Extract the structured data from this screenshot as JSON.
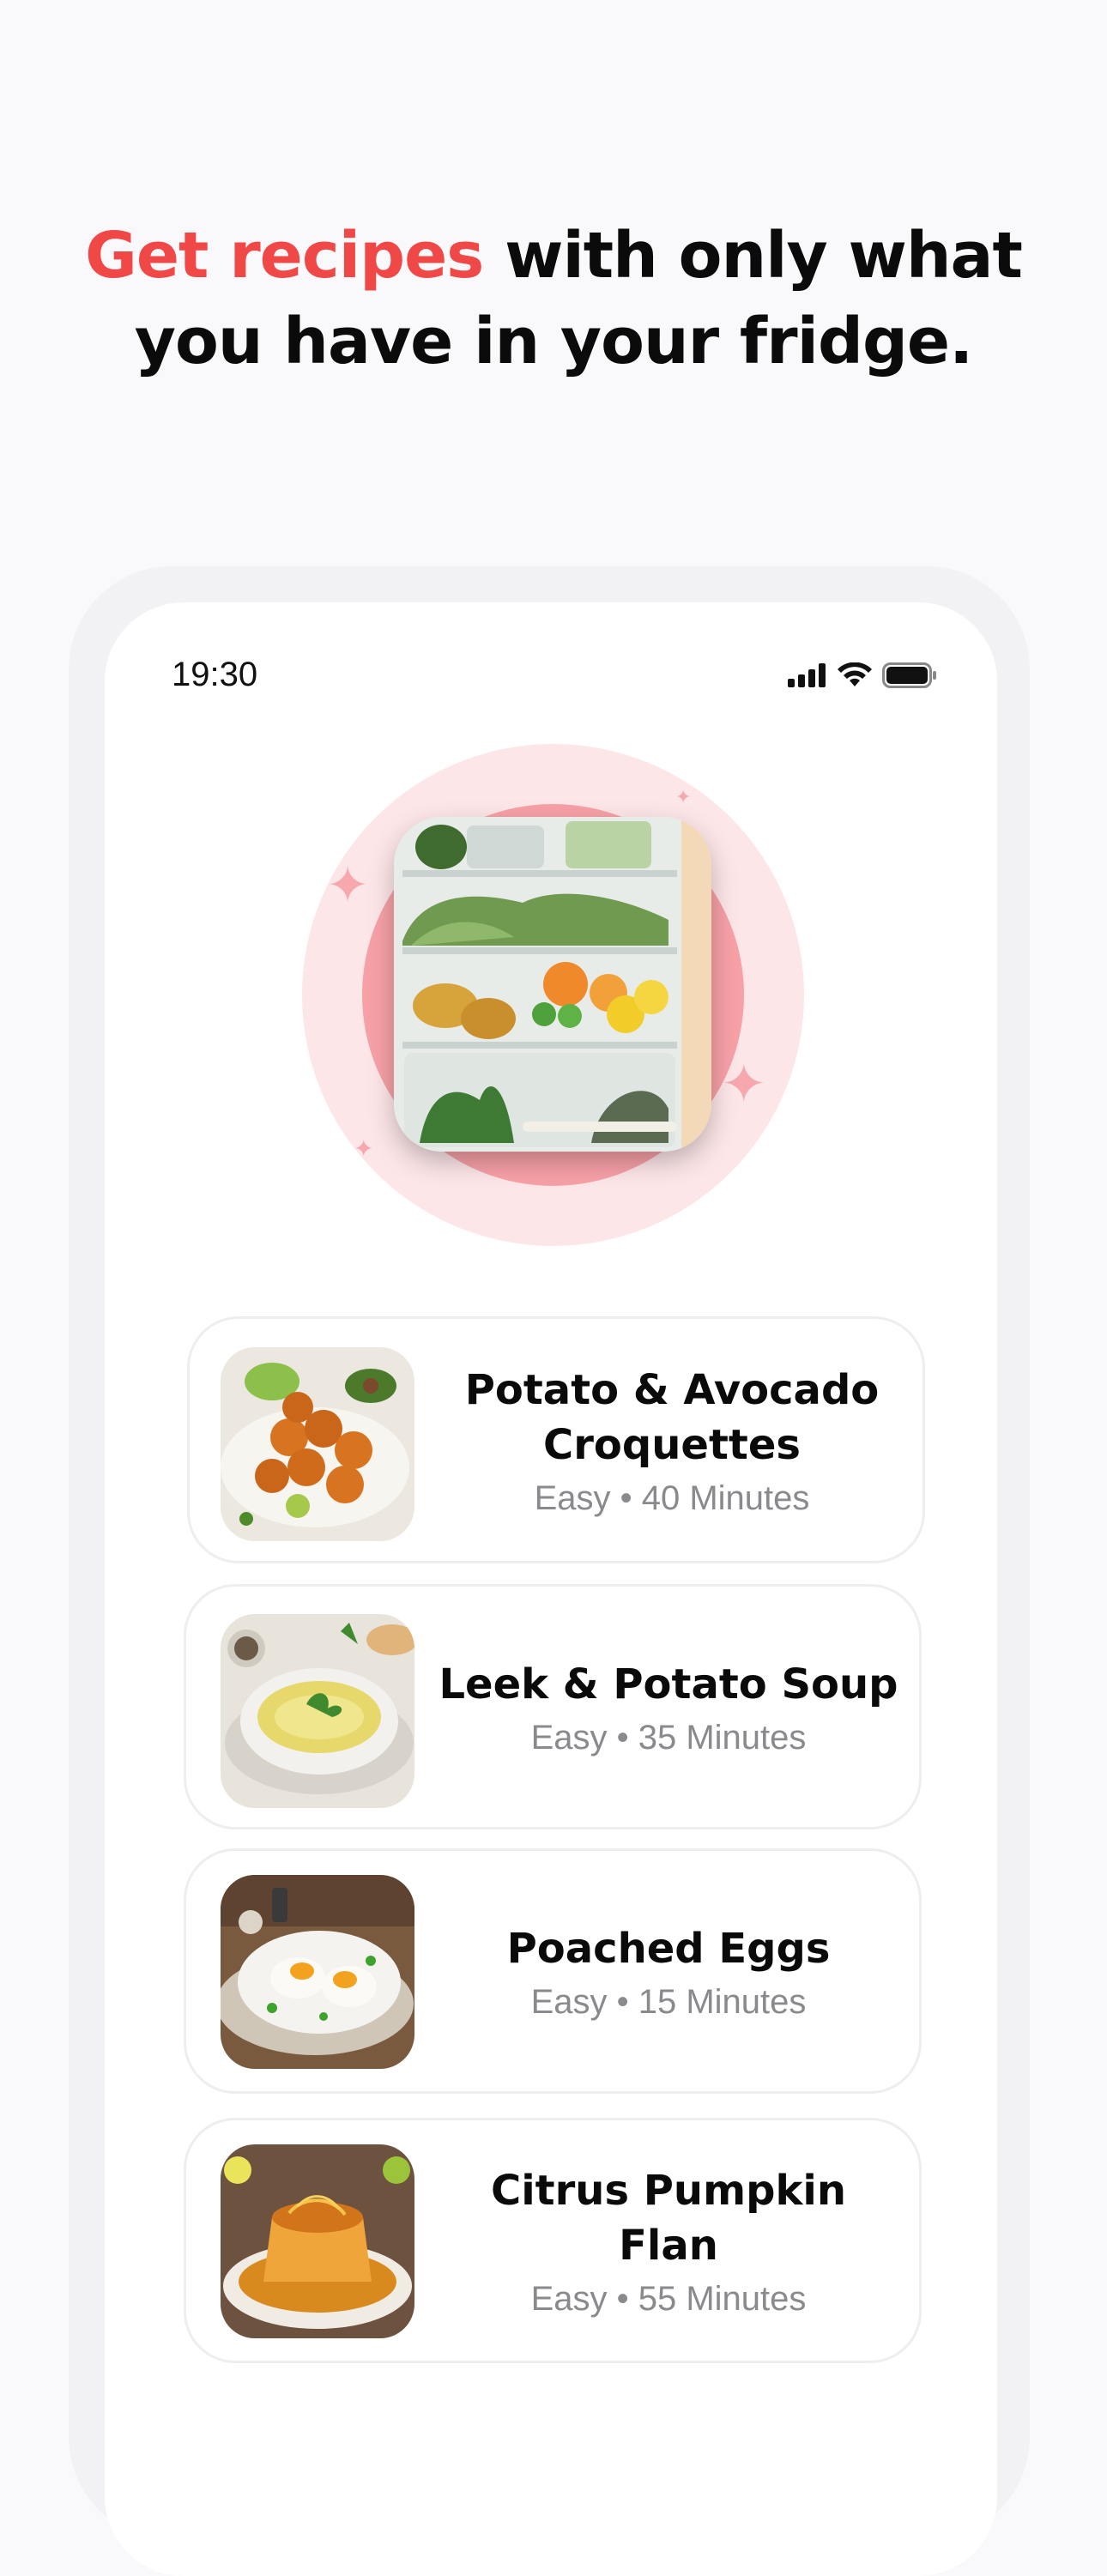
{
  "headline": {
    "accent": "Get recipes",
    "rest_line1": " with only what",
    "line2": "you have in your fridge."
  },
  "status_bar": {
    "time": "19:30",
    "icons": [
      "signal-icon",
      "wifi-icon",
      "battery-icon"
    ]
  },
  "hero": {
    "image": "fridge-image"
  },
  "recipes": [
    {
      "title": "Potato & Avocado Croquettes",
      "meta": "Easy • 40 Minutes",
      "image": "croquettes-image"
    },
    {
      "title": "Leek & Potato Soup",
      "meta": "Easy • 35 Minutes",
      "image": "soup-image"
    },
    {
      "title": "Poached Eggs",
      "meta": "Easy • 15 Minutes",
      "image": "eggs-image"
    },
    {
      "title": "Citrus Pumpkin Flan",
      "meta": "Easy • 55 Minutes",
      "image": "flan-image"
    }
  ],
  "colors": {
    "accent": "#f04747",
    "background": "#f9f9fb",
    "hero_ring": "#f7a1a7"
  }
}
